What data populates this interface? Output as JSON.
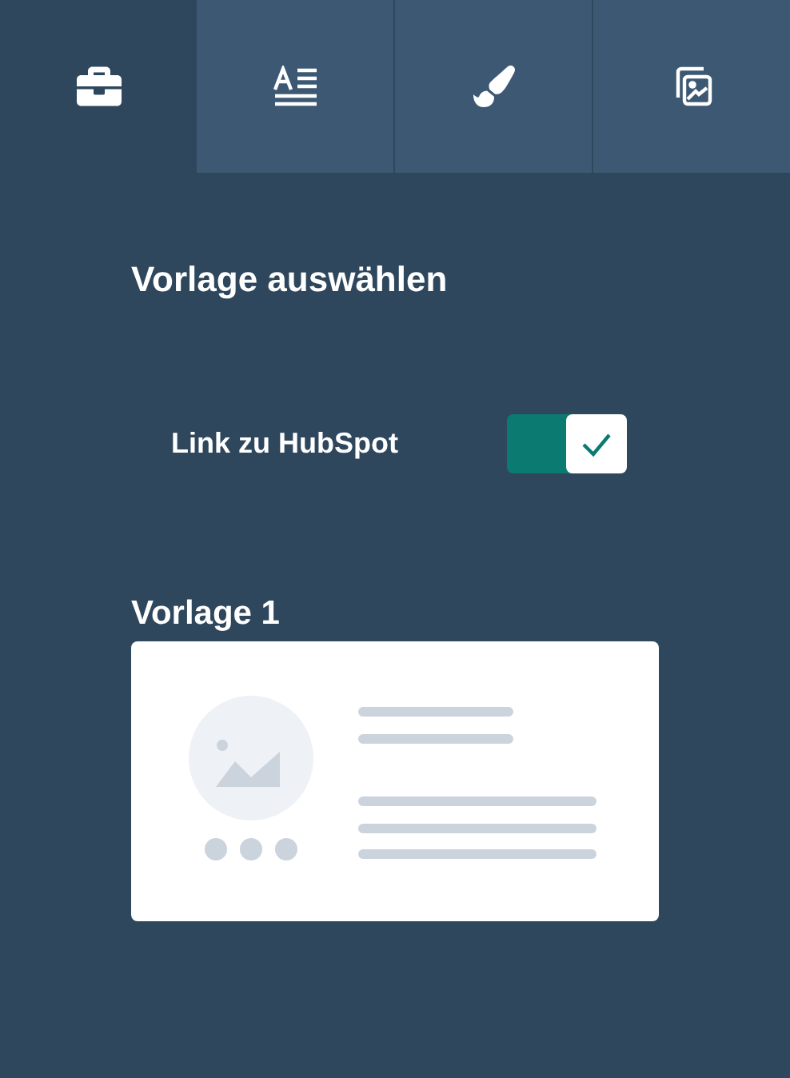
{
  "tabs": [
    {
      "selected": true
    },
    {
      "selected": false
    },
    {
      "selected": false
    },
    {
      "selected": false
    }
  ],
  "heading": "Vorlage auswählen",
  "toggle": {
    "label": "Link zu HubSpot",
    "on": true
  },
  "templates": [
    {
      "title": "Vorlage 1"
    }
  ]
}
